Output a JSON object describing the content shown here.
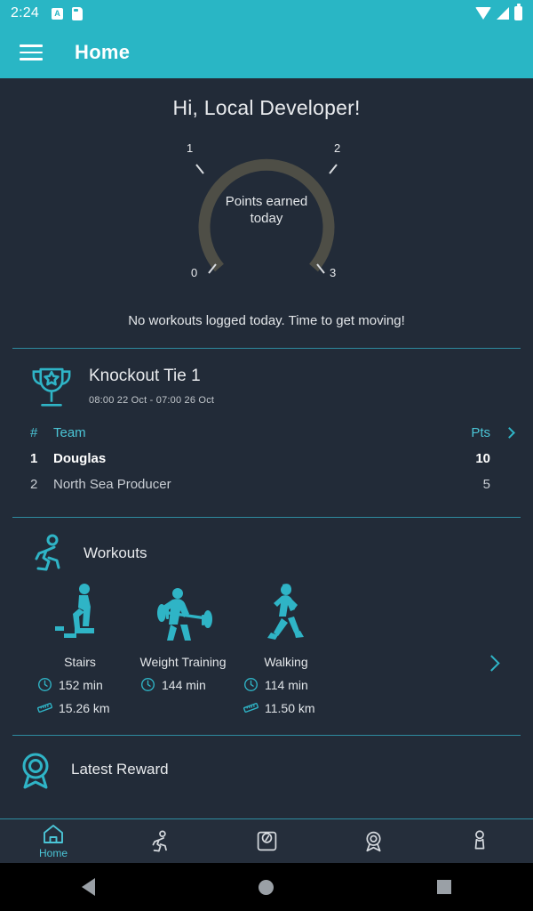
{
  "status_bar": {
    "time": "2:24",
    "left_icons": [
      "a-badge-icon",
      "sim-card-icon"
    ],
    "right_icons": [
      "wifi-icon",
      "signal-icon",
      "battery-icon"
    ],
    "a_badge_letter": "A"
  },
  "app_bar": {
    "menu_icon": "hamburger-menu-icon",
    "title": "Home",
    "background": "#29b6c5"
  },
  "greeting": "Hi, Local Developer!",
  "gauge": {
    "center_line1": "Points earned",
    "center_line2": "today",
    "ticks": [
      "0",
      "1",
      "2",
      "3"
    ],
    "min": 0,
    "max": 3,
    "value": 0,
    "track_color": "#4e4e46"
  },
  "empty_message": "No workouts logged today. Time to get moving!",
  "competition": {
    "icon": "trophy-icon",
    "title": "Knockout Tie 1",
    "dates": "08:00 22 Oct  -  07:00 26 Oct",
    "columns": {
      "rank": "#",
      "team": "Team",
      "points": "Pts"
    },
    "chevron_icon": "chevron-right-icon",
    "rows": [
      {
        "rank": "1",
        "team": "Douglas",
        "points": "10"
      },
      {
        "rank": "2",
        "team": "North Sea Producer",
        "points": "5"
      }
    ]
  },
  "workouts": {
    "icon": "running-person-icon",
    "title": "Workouts",
    "chevron_icon": "chevron-right-icon",
    "items": [
      {
        "figure_icon": "stairs-climber-icon",
        "name": "Stairs",
        "duration_icon": "clock-icon",
        "duration": "152 min",
        "distance_icon": "ruler-icon",
        "distance": "15.26 km"
      },
      {
        "figure_icon": "weight-lifter-icon",
        "name": "Weight Training",
        "duration_icon": "clock-icon",
        "duration": "144 min",
        "distance_icon": "",
        "distance": ""
      },
      {
        "figure_icon": "walking-person-icon",
        "name": "Walking",
        "duration_icon": "clock-icon",
        "duration": "114 min",
        "distance_icon": "ruler-icon",
        "distance": "11.50 km"
      }
    ]
  },
  "latest_reward": {
    "icon": "award-rosette-icon",
    "title": "Latest Reward"
  },
  "bottom_nav": {
    "active_index": 0,
    "items": [
      {
        "icon": "home-icon",
        "label": "Home"
      },
      {
        "icon": "running-icon",
        "label": ""
      },
      {
        "icon": "scale-icon",
        "label": ""
      },
      {
        "icon": "award-icon",
        "label": ""
      },
      {
        "icon": "person-icon",
        "label": ""
      }
    ]
  },
  "system_bar": {
    "back_icon": "android-back-icon",
    "home_icon": "android-home-icon",
    "recents_icon": "android-recents-icon"
  },
  "colors": {
    "accent": "#29b6c5",
    "background": "#222b38",
    "nav_background": "#252e3b",
    "divider": "#2e8ba0",
    "text_primary": "#e8eaed"
  }
}
